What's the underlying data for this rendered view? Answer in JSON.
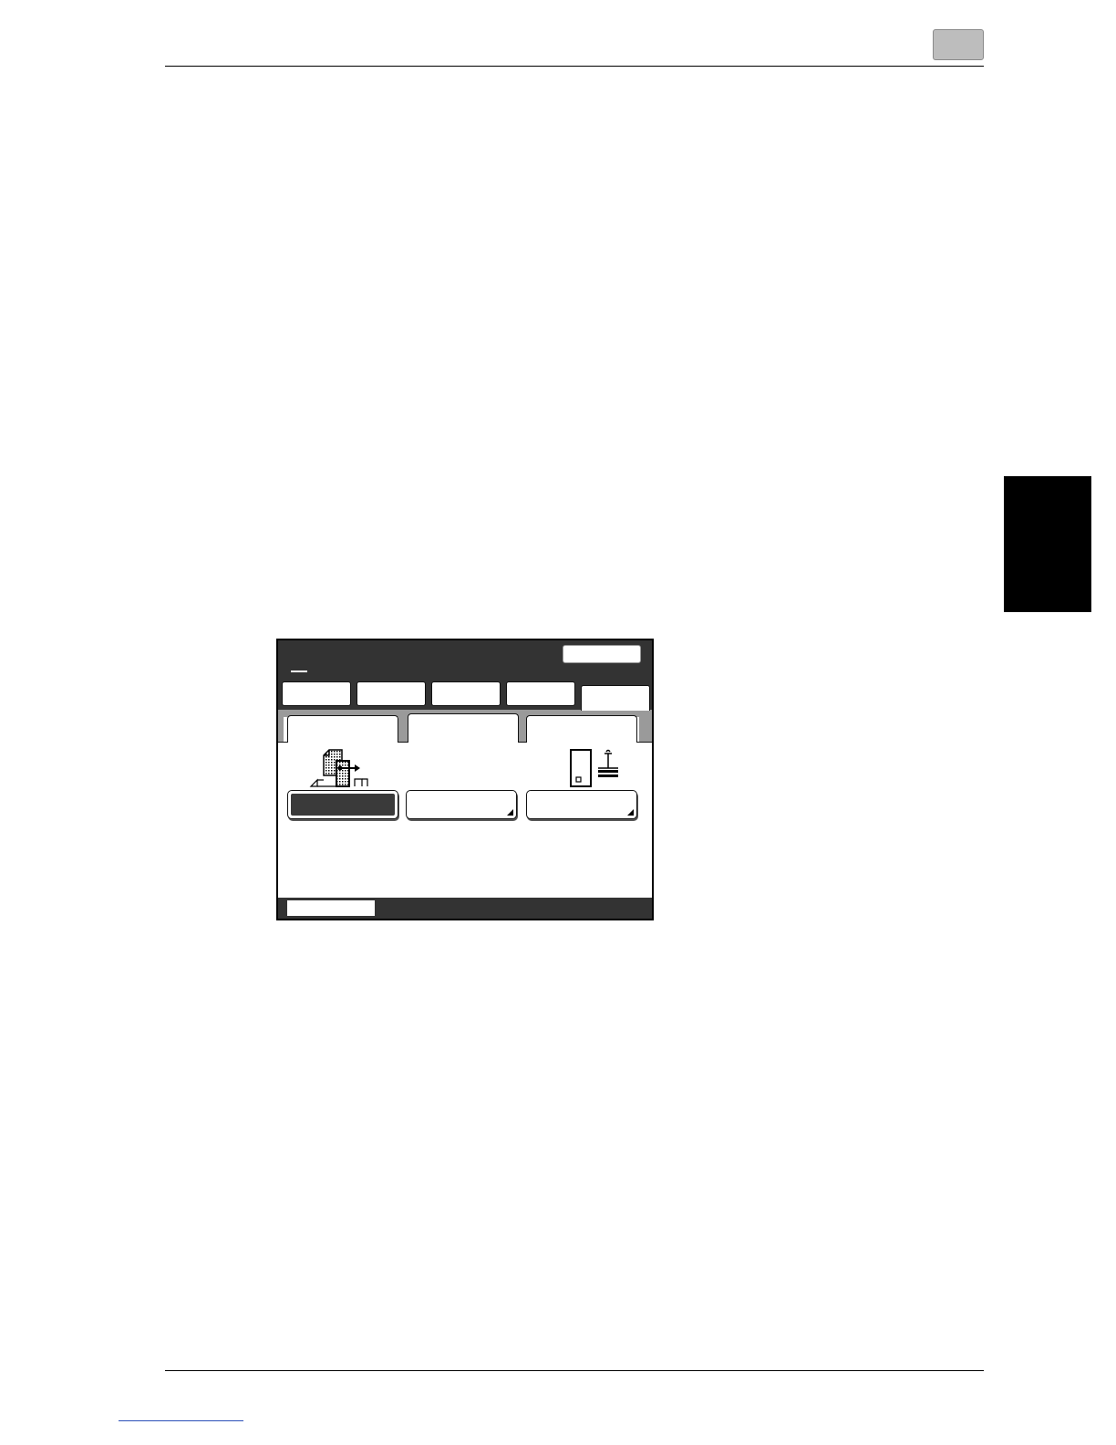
{
  "page": {
    "chapter_box_text": "",
    "side_tab_text": ""
  },
  "panel": {
    "header_button_label": "",
    "top_tabs": [
      {
        "label": ""
      },
      {
        "label": ""
      },
      {
        "label": ""
      },
      {
        "label": ""
      },
      {
        "label": ""
      }
    ],
    "active_top_tab_index": 4,
    "sub_tabs": [
      {
        "label": ""
      },
      {
        "label": ""
      },
      {
        "label": ""
      }
    ],
    "active_sub_tab_index": 1,
    "function_buttons": [
      {
        "label": "",
        "icon": "page-shift-icon",
        "selected": true
      },
      {
        "label": "",
        "icon": "",
        "selected": false
      },
      {
        "label": "",
        "icon": "stamp-icon",
        "selected": false
      }
    ],
    "status_bar_text": ""
  },
  "colors": {
    "panel_dark": "#333333",
    "tab_strip_gray": "#9a9a9a",
    "side_tab": "#000000",
    "chapter_box": "#bdbdbd",
    "footer_link": "#2b4fb8"
  }
}
